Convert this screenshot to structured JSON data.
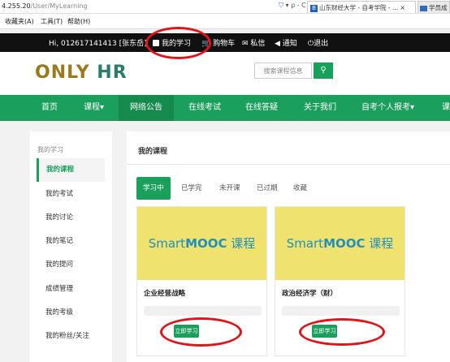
{
  "browser": {
    "url_host": "4.255.20",
    "url_path": "/User/MyLearning",
    "addr_controls": "▾ ρ - C",
    "active_tab_label": "山东财经大学 - 自考学院 - ...",
    "active_tab_icon_letter": "B",
    "inactive_tab_label": "学员成",
    "close_glyph": "×",
    "menu": [
      "收藏夹(A)",
      "工具(T)",
      "帮助(H)"
    ]
  },
  "topbar": {
    "greeting": "Hi,  012617141413 [张东岳]",
    "my_learning": "我的学习",
    "cart": "购物车",
    "messages": "私信",
    "notice": "通知",
    "logout": "退出"
  },
  "header": {
    "logo_only": "ONLY",
    "logo_hr": " HR",
    "search_placeholder": "搜索课程信息",
    "search_icon": "🔍"
  },
  "nav": {
    "items": [
      "首页",
      "课程▾",
      "网络公告",
      "在线考试",
      "在线答疑",
      "关于我们",
      "自考个人报考▾",
      "课"
    ]
  },
  "sidebar": {
    "title": "我的学习",
    "items": [
      "我的课程",
      "我的考试",
      "我的讨论",
      "我的笔记",
      "我的提问",
      "成绩管理",
      "我的考级",
      "我的粉丝/关注"
    ]
  },
  "main": {
    "heading": "我的课程",
    "tabs": [
      "学习中",
      "已学完",
      "未开课",
      "已过期",
      "收藏"
    ],
    "cards": [
      {
        "banner_prefix": "Smart",
        "banner_bold": "MOOC",
        "banner_suffix": " 课程",
        "name": "企业经营战略",
        "button": "立即学习",
        "progress": 0
      },
      {
        "banner_prefix": "Smart",
        "banner_bold": "MOOC",
        "banner_suffix": " 课程",
        "name": "政治经济学（财）",
        "button": "立即学习",
        "progress": 0
      }
    ]
  },
  "colors": {
    "brand_green": "#1aa05c",
    "annotation_red": "#e0151b",
    "banner_yellow": "#f0e26f"
  }
}
